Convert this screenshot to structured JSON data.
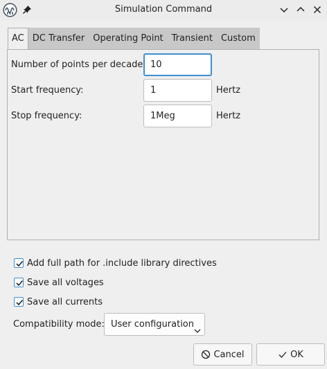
{
  "window": {
    "title": "Simulation Command"
  },
  "tabs": [
    {
      "label": "AC",
      "active": true
    },
    {
      "label": "DC Transfer",
      "active": false
    },
    {
      "label": "Operating Point",
      "active": false
    },
    {
      "label": "Transient",
      "active": false
    },
    {
      "label": "Custom",
      "active": false
    }
  ],
  "ac": {
    "points_label": "Number of points per decade:",
    "points_value": "10",
    "start_label": "Start frequency:",
    "start_value": "1",
    "start_unit": "Hertz",
    "stop_label": "Stop frequency:",
    "stop_value": "1Meg",
    "stop_unit": "Hertz"
  },
  "options": [
    {
      "label": "Add full path for .include library directives",
      "checked": true
    },
    {
      "label": "Save all voltages",
      "checked": true
    },
    {
      "label": "Save all currents",
      "checked": true
    }
  ],
  "compat": {
    "label": "Compatibility mode:",
    "selected": "User configuration"
  },
  "buttons": {
    "cancel": "Cancel",
    "ok": "OK"
  },
  "colors": {
    "accent": "#3d8fd1",
    "tab_inactive": "#c8c8c8",
    "background": "#efefef"
  },
  "icons": {
    "app": "kicad-simulator-icon",
    "pin": "pin-icon",
    "minimize": "chevron-down-icon",
    "maximize": "chevron-up-icon",
    "close": "close-icon",
    "cancel": "cancel-circle-icon",
    "ok": "checkmark-icon"
  }
}
